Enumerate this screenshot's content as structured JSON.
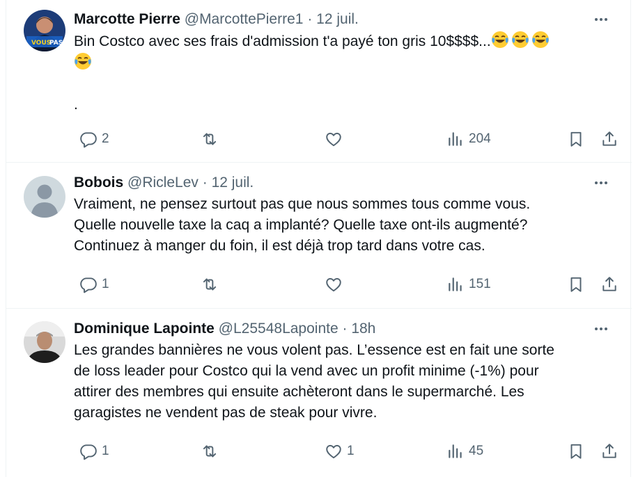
{
  "tweets": [
    {
      "name": "Marcotte Pierre",
      "handle": "@MarcottePierre1",
      "separator": "·",
      "time": "12 juil.",
      "text_line1": "Bin Costco avec ses frais d'admission t'a payé ton gris 10$$$$...",
      "text_dot": ".",
      "emoji": "face-with-tears-of-joy",
      "emoji_count": 4,
      "avatar_text_1": "VOUS",
      "avatar_text_2": "PAS",
      "replies": "2",
      "retweets": "",
      "likes": "",
      "views": "204"
    },
    {
      "name": "Bobois",
      "handle": "@RicleLev",
      "separator": "·",
      "time": "12 juil.",
      "lines": [
        "Vraiment, ne pensez surtout pas que nous sommes tous comme vous.",
        "Quelle nouvelle taxe la caq a implanté? Quelle taxe ont-ils augmenté?",
        "Continuez à manger du foin, il est déjà trop tard dans votre cas."
      ],
      "replies": "1",
      "retweets": "",
      "likes": "",
      "views": "151"
    },
    {
      "name": "Dominique Lapointe",
      "handle": "@L25548Lapointe",
      "separator": "·",
      "time": "18h",
      "lines": [
        "Les grandes bannières ne vous volent pas. L’essence est en fait une sorte",
        "de loss leader pour Costco qui la vend avec un profit minime (-1%) pour",
        "attirer des membres qui ensuite achèteront dans le supermarché. Les",
        "garagistes ne vendent pas de steak pour vivre."
      ],
      "replies": "1",
      "retweets": "",
      "likes": "1",
      "views": "45"
    }
  ],
  "icons": {
    "reply": "reply-icon",
    "retweet": "retweet-icon",
    "like": "heart-icon",
    "views": "views-icon",
    "bookmark": "bookmark-icon",
    "share": "share-icon",
    "more": "more-icon"
  },
  "colors": {
    "text": "#0f1419",
    "secondary": "#536471",
    "divider": "#eff3f4"
  }
}
